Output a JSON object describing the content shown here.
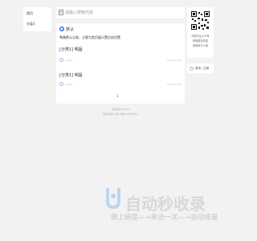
{
  "nav": {
    "items": [
      {
        "label": "首页"
      },
      {
        "label": "分类1"
      }
    ]
  },
  "search": {
    "placeholder": "请输入搜索内容"
  },
  "notice": {
    "badge": "默认",
    "text": "粤美默认分类，主要为首页展示置位由设置"
  },
  "posts": [
    {
      "category": "[分类1] 喝猛",
      "author": "admin",
      "date": "2023-11-20"
    },
    {
      "category": "[分类1] 喝猛",
      "author": "admin",
      "date": "2023-11-20"
    }
  ],
  "pagination": {
    "current": "1"
  },
  "footer": {
    "line1": "系统首页 | 2023",
    "line2": "网站声明 | 某ICP备000000号-1"
  },
  "sidebar": {
    "qr_caption1": "扫码关注公众号",
    "qr_caption2": "获取更多内容",
    "qr_caption3": "看看有什么新",
    "login_label": "登录 / 注册"
  },
  "watermark": {
    "title": "自动秒收录",
    "subtitle": "做上链接—→来访一次—→自动收录"
  }
}
